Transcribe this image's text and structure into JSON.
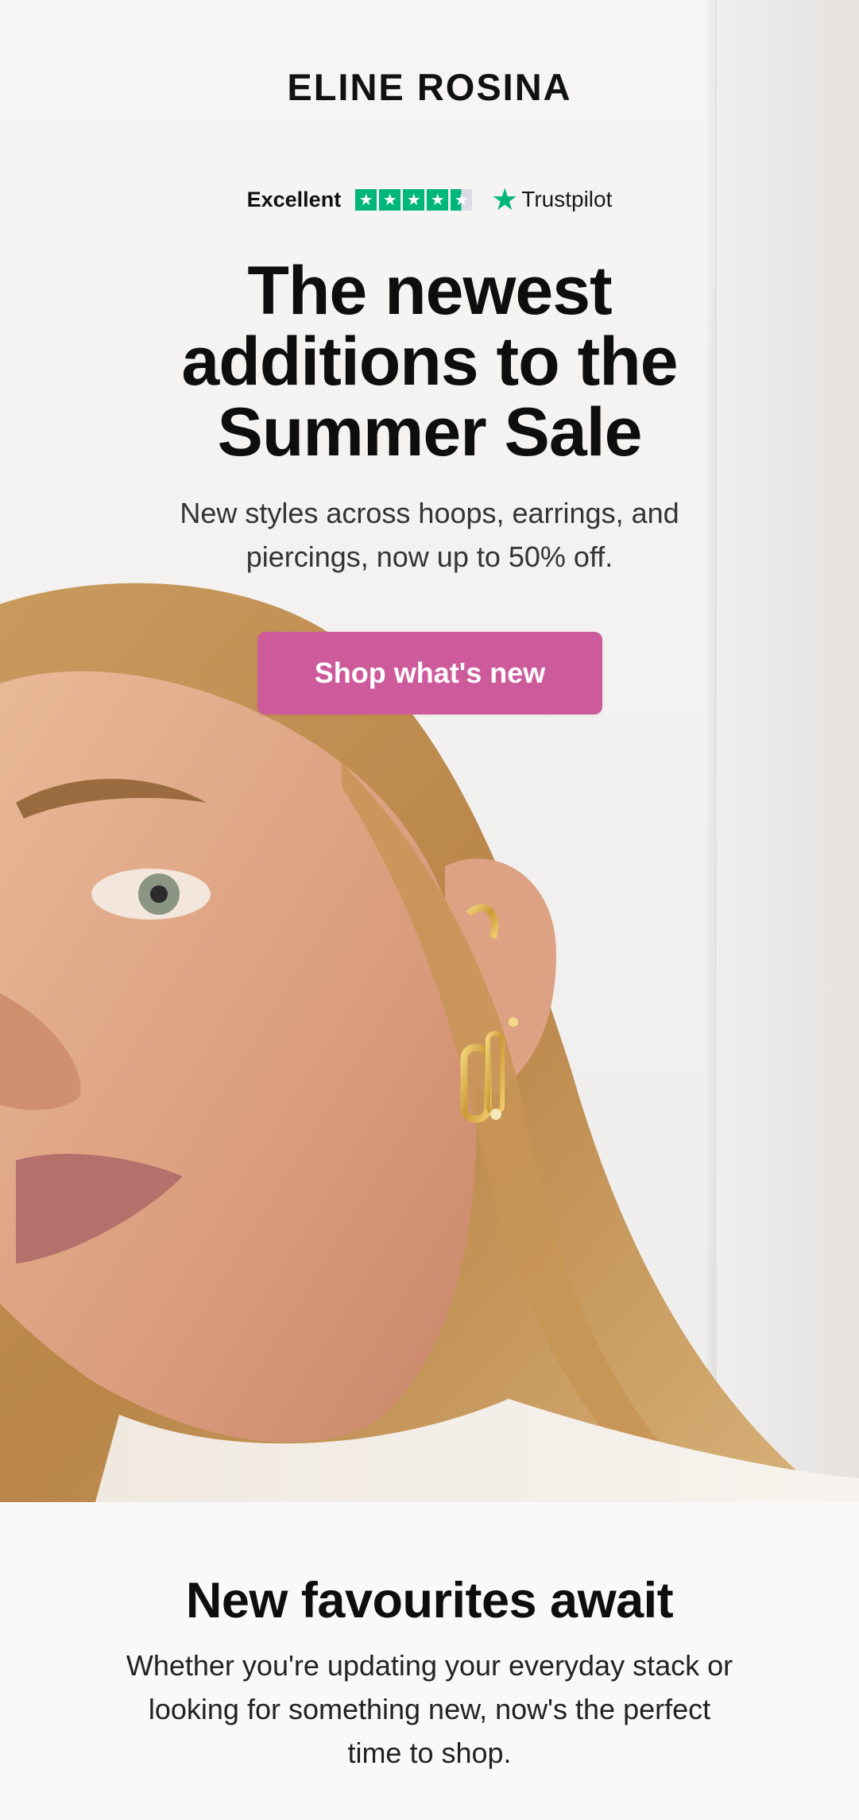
{
  "brand": {
    "logo_text": "ELINE ROSINA"
  },
  "rating": {
    "label": "Excellent",
    "stars": 4.5,
    "provider": "Trustpilot",
    "star_icon": "star-icon",
    "star_color": "#00b67a"
  },
  "hero": {
    "headline_lines": [
      "The newest",
      "additions to the",
      "Summer Sale"
    ],
    "subhead_lines": [
      "New styles across hoops, earrings, and",
      "piercings, now up to 50% off."
    ],
    "cta_label": "Shop what's new",
    "cta_color": "#cd5a9b",
    "image_alt": "Model wearing gold hoop earrings and ear cuff"
  },
  "section": {
    "title": "New favourites await",
    "text_lines": [
      "Whether you're updating your everyday stack or",
      "looking for something new, now's the perfect",
      "time to shop."
    ]
  }
}
